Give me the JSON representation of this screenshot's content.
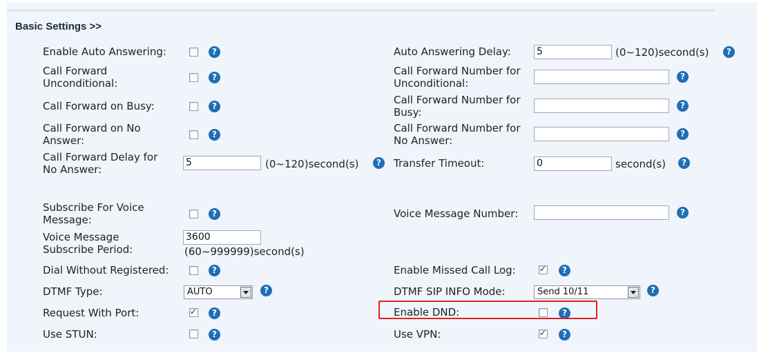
{
  "section_title": "Basic Settings >>",
  "help_glyph": "?",
  "left": {
    "auto_answer": {
      "label": "Enable Auto Answering:",
      "checked": false
    },
    "cf_uncond": {
      "label1": "Call Forward",
      "label2": "Unconditional:",
      "checked": false
    },
    "cf_busy": {
      "label": "Call Forward on Busy:",
      "checked": false
    },
    "cf_noans": {
      "label1": "Call Forward on No",
      "label2": "Answer:",
      "checked": false
    },
    "cf_delay": {
      "label1": "Call Forward Delay for",
      "label2": "No Answer:",
      "value": "5",
      "range": "(0~120)second(s)"
    },
    "sub_voice": {
      "label1": "Subscribe For Voice",
      "label2": "Message:",
      "checked": false
    },
    "vm_period": {
      "label1": "Voice Message",
      "label2": "Subscribe Period:",
      "value": "3600",
      "range": "(60~999999)second(s)"
    },
    "dial_unreg": {
      "label": "Dial Without Registered:",
      "checked": false
    },
    "dtmf_type": {
      "label": "DTMF Type:",
      "value": "AUTO"
    },
    "req_port": {
      "label": "Request With Port:",
      "checked": true
    },
    "stun": {
      "label": "Use STUN:",
      "checked": false
    }
  },
  "right": {
    "auto_delay": {
      "label": "Auto Answering Delay:",
      "value": "5",
      "range": "(0~120)second(s)"
    },
    "cfn_uncond": {
      "label1": "Call Forward Number for",
      "label2": "Unconditional:",
      "value": ""
    },
    "cfn_busy": {
      "label1": "Call Forward Number for",
      "label2": "Busy:",
      "value": ""
    },
    "cfn_noans": {
      "label1": "Call Forward Number for",
      "label2": "No Answer:",
      "value": ""
    },
    "transfer": {
      "label": "Transfer Timeout:",
      "value": "0",
      "unit": "second(s)"
    },
    "vm_number": {
      "label": "Voice Message Number:",
      "value": ""
    },
    "missed_log": {
      "label": "Enable Missed Call Log:",
      "checked": true
    },
    "sip_info": {
      "label": "DTMF SIP INFO Mode:",
      "value": "Send 10/11"
    },
    "dnd": {
      "label": "Enable DND:",
      "checked": false
    },
    "vpn": {
      "label": "Use VPN:",
      "checked": true
    }
  },
  "colors": {
    "highlight": "#e0201c",
    "help": "#1f6eb6",
    "panel": "#f0f4fb"
  }
}
